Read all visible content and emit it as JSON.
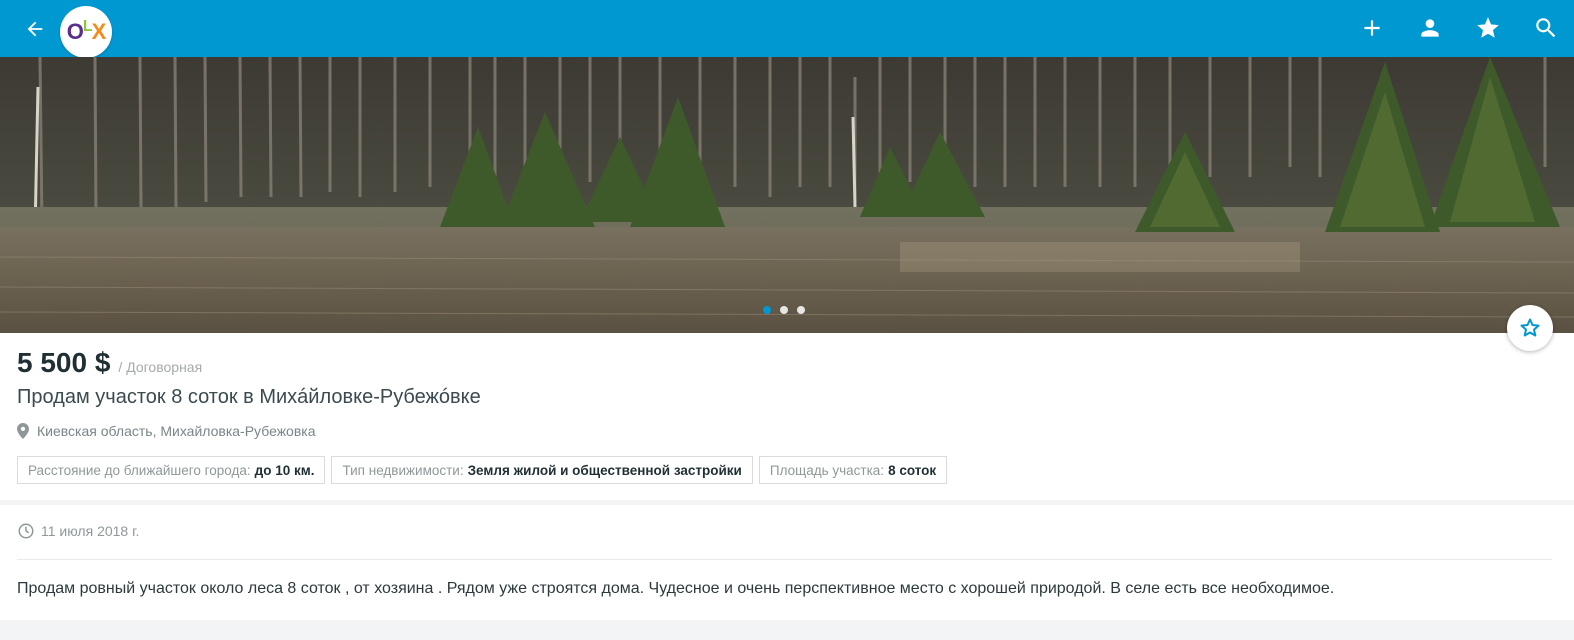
{
  "header": {
    "logo_letters": {
      "o": "O",
      "l": "L",
      "x": "X"
    },
    "brand_color": "#0098d0",
    "icons": [
      "back-arrow-icon",
      "plus-icon",
      "user-icon",
      "star-icon",
      "search-icon"
    ]
  },
  "gallery": {
    "image_count": 3,
    "active_index": 0
  },
  "listing": {
    "price": "5 500 $",
    "negotiable": "/ Договорная",
    "title": "Продам участок 8 соток в Михáйловке-Рубежóвке",
    "location": "Киевская область, Михайловка-Рубежовка",
    "params": [
      {
        "label": "Расстояние до ближайшего города:",
        "value": "до 10 км."
      },
      {
        "label": "Тип недвижимости:",
        "value": "Земля жилой и общественной застройки"
      },
      {
        "label": "Площадь участка:",
        "value": "8 соток"
      }
    ],
    "date": "11 июля 2018 г.",
    "description": "Продам ровный участок около леса 8 соток , от хозяина . Рядом уже строятся дома. Чудесное и очень перспективное место с хорошей природой. В селе есть все необходимое."
  }
}
